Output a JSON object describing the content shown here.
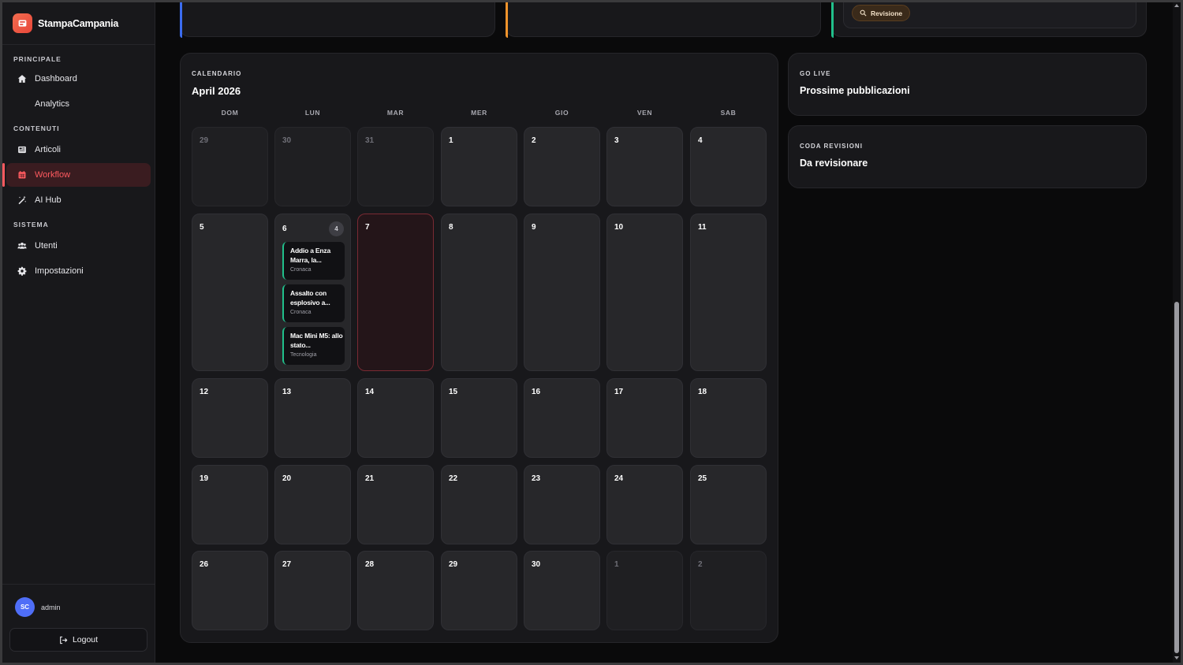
{
  "brand": {
    "name": "StampaCampania"
  },
  "nav": {
    "sections": [
      {
        "label": "PRINCIPALE",
        "items": [
          {
            "label": "Dashboard",
            "icon": "home-icon"
          },
          {
            "label": "Analytics",
            "icon": ""
          }
        ]
      },
      {
        "label": "CONTENUTI",
        "items": [
          {
            "label": "Articoli",
            "icon": "newspaper-icon"
          },
          {
            "label": "Workflow",
            "icon": "calendar-icon",
            "active": true
          },
          {
            "label": "AI Hub",
            "icon": "magic-wand-icon"
          }
        ]
      },
      {
        "label": "SISTEMA",
        "items": [
          {
            "label": "Utenti",
            "icon": "users-icon"
          },
          {
            "label": "Impostazioni",
            "icon": "gear-icon"
          }
        ]
      }
    ]
  },
  "user": {
    "initials": "SC",
    "name": "admin"
  },
  "logout_label": "Logout",
  "top_cards": {
    "review_pill": "Revisione",
    "accents": [
      "#3b6cf0",
      "#f0932b",
      "#21c08b"
    ]
  },
  "calendar": {
    "eyebrow": "CALENDARIO",
    "title": "April 2026",
    "weekdays": [
      "DOM",
      "LUN",
      "MAR",
      "MER",
      "GIO",
      "VEN",
      "SAB"
    ],
    "weeks": [
      [
        {
          "n": "29",
          "other": true
        },
        {
          "n": "30",
          "other": true
        },
        {
          "n": "31",
          "other": true
        },
        {
          "n": "1"
        },
        {
          "n": "2"
        },
        {
          "n": "3"
        },
        {
          "n": "4"
        }
      ],
      [
        {
          "n": "5"
        },
        {
          "n": "6",
          "badge": "4",
          "events": [
            {
              "title": "Addio a Enza Marra, la...",
              "category": "Cronaca"
            },
            {
              "title": "Assalto con esplosivo a...",
              "category": "Cronaca"
            },
            {
              "title": "Mac Mini M5: allo stato...",
              "category": "Tecnologia"
            }
          ]
        },
        {
          "n": "7",
          "today": true
        },
        {
          "n": "8"
        },
        {
          "n": "9"
        },
        {
          "n": "10"
        },
        {
          "n": "11"
        }
      ],
      [
        {
          "n": "12"
        },
        {
          "n": "13"
        },
        {
          "n": "14"
        },
        {
          "n": "15"
        },
        {
          "n": "16"
        },
        {
          "n": "17"
        },
        {
          "n": "18"
        }
      ],
      [
        {
          "n": "19"
        },
        {
          "n": "20"
        },
        {
          "n": "21"
        },
        {
          "n": "22"
        },
        {
          "n": "23"
        },
        {
          "n": "24"
        },
        {
          "n": "25"
        }
      ],
      [
        {
          "n": "26"
        },
        {
          "n": "27"
        },
        {
          "n": "28"
        },
        {
          "n": "29"
        },
        {
          "n": "30"
        },
        {
          "n": "1",
          "other": true
        },
        {
          "n": "2",
          "other": true
        }
      ]
    ]
  },
  "go_live": {
    "eyebrow": "GO LIVE",
    "title": "Prossime pubblicazioni"
  },
  "review_queue": {
    "eyebrow": "CODA REVISIONI",
    "title": "Da revisionare"
  },
  "colors": {
    "accent": "#ff5a5f",
    "event": "#21c08b"
  }
}
